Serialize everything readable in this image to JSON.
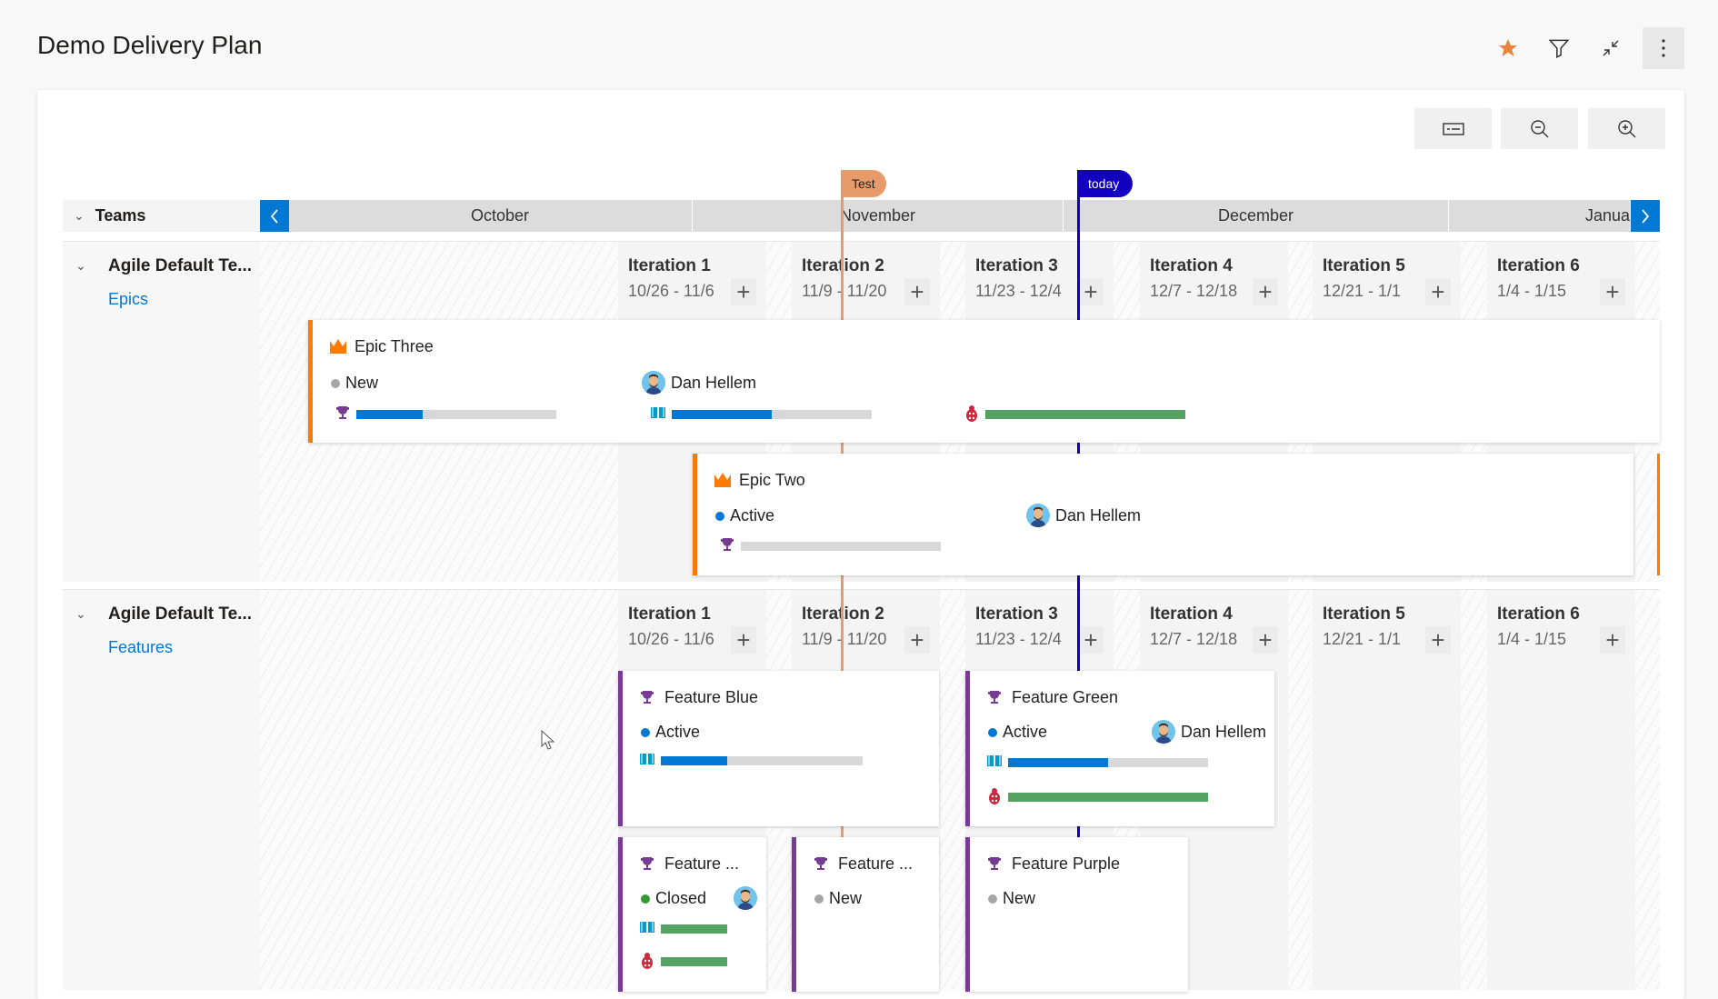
{
  "header": {
    "title": "Demo Delivery Plan",
    "icons": [
      "star-icon",
      "filter-icon",
      "collapse-icon",
      "more-options-icon"
    ],
    "favorite_color": "#e8853d"
  },
  "toolbar": {
    "icons": [
      "card-fields-icon",
      "zoom-out-icon",
      "zoom-in-icon"
    ]
  },
  "markers": [
    {
      "label": "Test",
      "color": "#e89b6a"
    },
    {
      "label": "today",
      "color": "#1100c0"
    }
  ],
  "timeline": {
    "teams_label": "Teams",
    "months": [
      "October",
      "November",
      "December",
      "Janua"
    ]
  },
  "teams": [
    {
      "name": "Agile Default Te...",
      "backlog": "Epics",
      "iterations": [
        {
          "name": "Iteration 1",
          "dates": "10/26 - 11/6"
        },
        {
          "name": "Iteration 2",
          "dates": "11/9 - 11/20"
        },
        {
          "name": "Iteration 3",
          "dates": "11/23 - 12/4"
        },
        {
          "name": "Iteration 4",
          "dates": "12/7 - 12/18"
        },
        {
          "name": "Iteration 5",
          "dates": "12/21 - 1/1"
        },
        {
          "name": "Iteration 6",
          "dates": "1/4 - 1/15"
        }
      ],
      "cards": [
        {
          "title": "Epic Three",
          "type": "epic",
          "state": "New",
          "state_color": "#a6a6a6",
          "assignee": "Dan Hellem",
          "rollups": [
            {
              "icon": "trophy-icon",
              "progress": 0.33,
              "color": "#0078d4"
            },
            {
              "icon": "book-icon",
              "progress": 0.5,
              "color": "#0078d4"
            },
            {
              "icon": "bug-icon",
              "progress": 1.0,
              "color": "#55a362"
            }
          ]
        },
        {
          "title": "Epic Two",
          "type": "epic",
          "state": "Active",
          "state_color": "#0078d4",
          "assignee": "Dan Hellem",
          "rollups": [
            {
              "icon": "trophy-icon",
              "progress": 0,
              "color": "#0078d4"
            }
          ]
        }
      ]
    },
    {
      "name": "Agile Default Te...",
      "backlog": "Features",
      "iterations": [
        {
          "name": "Iteration 1",
          "dates": "10/26 - 11/6"
        },
        {
          "name": "Iteration 2",
          "dates": "11/9 - 11/20"
        },
        {
          "name": "Iteration 3",
          "dates": "11/23 - 12/4"
        },
        {
          "name": "Iteration 4",
          "dates": "12/7 - 12/18"
        },
        {
          "name": "Iteration 5",
          "dates": "12/21 - 1/1"
        },
        {
          "name": "Iteration 6",
          "dates": "1/4 - 1/15"
        }
      ],
      "cards": [
        {
          "title": "Feature Blue",
          "type": "feature",
          "state": "Active",
          "state_color": "#0078d4",
          "assignee": "",
          "rollups": [
            {
              "icon": "book-icon",
              "progress": 0.33,
              "color": "#0078d4"
            }
          ]
        },
        {
          "title": "Feature Green",
          "type": "feature",
          "state": "Active",
          "state_color": "#0078d4",
          "assignee": "Dan Hellem",
          "rollups": [
            {
              "icon": "book-icon",
              "progress": 0.5,
              "color": "#0078d4"
            },
            {
              "icon": "bug-icon",
              "progress": 1.0,
              "color": "#55a362"
            }
          ]
        },
        {
          "title": "Feature ...",
          "type": "feature",
          "state": "Closed",
          "state_color": "#339933",
          "assignee": "",
          "rollups": [
            {
              "icon": "book-icon",
              "progress": 1.0,
              "color": "#55a362"
            },
            {
              "icon": "bug-icon",
              "progress": 1.0,
              "color": "#55a362"
            }
          ]
        },
        {
          "title": "Feature ...",
          "type": "feature",
          "state": "New",
          "state_color": "#a6a6a6",
          "assignee": "",
          "rollups": []
        },
        {
          "title": "Feature Purple",
          "type": "feature",
          "state": "New",
          "state_color": "#a6a6a6",
          "assignee": "",
          "rollups": []
        }
      ]
    }
  ],
  "colors": {
    "epic": "#ff7b00",
    "feature": "#773b93",
    "accent": "#0078d4"
  }
}
